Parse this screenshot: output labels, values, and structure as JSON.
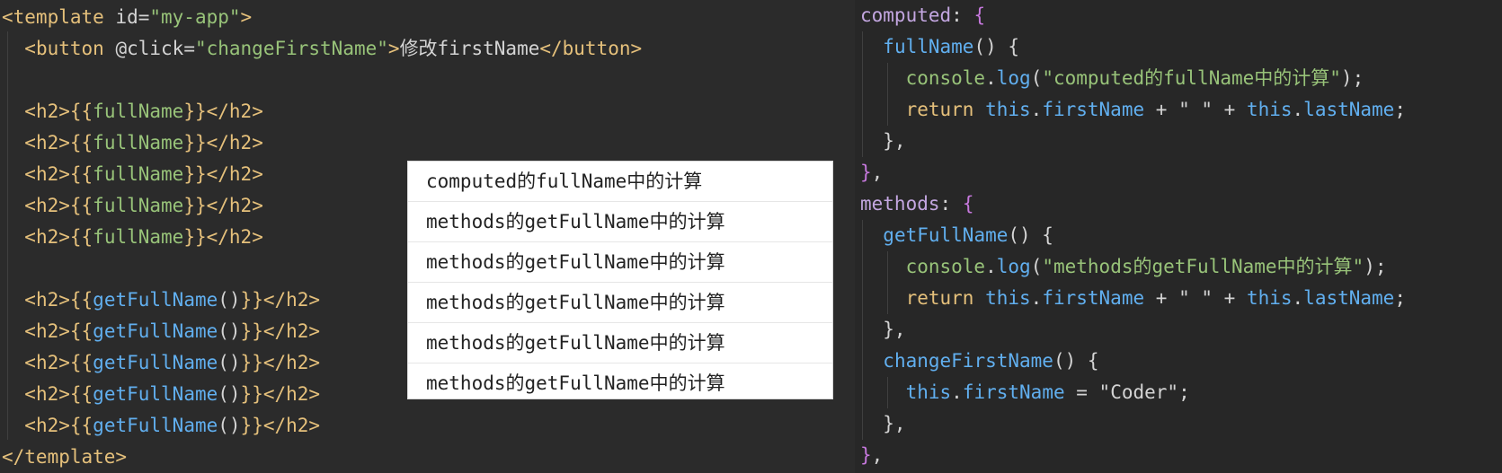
{
  "template_lines": [
    {
      "parts": [
        [
          "tag",
          "<template"
        ],
        [
          "attr",
          " id="
        ],
        [
          "str",
          "\"my-app\""
        ],
        [
          "tag",
          ">"
        ]
      ]
    },
    {
      "parts": [
        [
          "plain",
          "  "
        ],
        [
          "tag",
          "<button"
        ],
        [
          "attr",
          " @click="
        ],
        [
          "str",
          "\"changeFirstName\""
        ],
        [
          "tag",
          ">"
        ],
        [
          "plain",
          "修改firstName"
        ],
        [
          "tag",
          "</button>"
        ]
      ]
    },
    {
      "parts": [
        [
          "plain",
          ""
        ]
      ]
    },
    {
      "parts": [
        [
          "plain",
          "  "
        ],
        [
          "tag",
          "<h2>"
        ],
        [
          "mustache",
          "{{"
        ],
        [
          "expr",
          "fullName"
        ],
        [
          "mustache",
          "}}"
        ],
        [
          "tag",
          "</h2>"
        ]
      ]
    },
    {
      "parts": [
        [
          "plain",
          "  "
        ],
        [
          "tag",
          "<h2>"
        ],
        [
          "mustache",
          "{{"
        ],
        [
          "expr",
          "fullName"
        ],
        [
          "mustache",
          "}}"
        ],
        [
          "tag",
          "</h2>"
        ]
      ]
    },
    {
      "parts": [
        [
          "plain",
          "  "
        ],
        [
          "tag",
          "<h2>"
        ],
        [
          "mustache",
          "{{"
        ],
        [
          "expr",
          "fullName"
        ],
        [
          "mustache",
          "}}"
        ],
        [
          "tag",
          "</h2>"
        ]
      ]
    },
    {
      "parts": [
        [
          "plain",
          "  "
        ],
        [
          "tag",
          "<h2>"
        ],
        [
          "mustache",
          "{{"
        ],
        [
          "expr",
          "fullName"
        ],
        [
          "mustache",
          "}}"
        ],
        [
          "tag",
          "</h2>"
        ]
      ]
    },
    {
      "parts": [
        [
          "plain",
          "  "
        ],
        [
          "tag",
          "<h2>"
        ],
        [
          "mustache",
          "{{"
        ],
        [
          "expr",
          "fullName"
        ],
        [
          "mustache",
          "}}"
        ],
        [
          "tag",
          "</h2>"
        ]
      ]
    },
    {
      "parts": [
        [
          "plain",
          ""
        ]
      ]
    },
    {
      "parts": [
        [
          "plain",
          "  "
        ],
        [
          "tag",
          "<h2>"
        ],
        [
          "mustache",
          "{{"
        ],
        [
          "fn",
          "getFullName"
        ],
        [
          "plain",
          "()"
        ],
        [
          "mustache",
          "}}"
        ],
        [
          "tag",
          "</h2>"
        ]
      ]
    },
    {
      "parts": [
        [
          "plain",
          "  "
        ],
        [
          "tag",
          "<h2>"
        ],
        [
          "mustache",
          "{{"
        ],
        [
          "fn",
          "getFullName"
        ],
        [
          "plain",
          "()"
        ],
        [
          "mustache",
          "}}"
        ],
        [
          "tag",
          "</h2>"
        ]
      ]
    },
    {
      "parts": [
        [
          "plain",
          "  "
        ],
        [
          "tag",
          "<h2>"
        ],
        [
          "mustache",
          "{{"
        ],
        [
          "fn",
          "getFullName"
        ],
        [
          "plain",
          "()"
        ],
        [
          "mustache",
          "}}"
        ],
        [
          "tag",
          "</h2>"
        ]
      ]
    },
    {
      "parts": [
        [
          "plain",
          "  "
        ],
        [
          "tag",
          "<h2>"
        ],
        [
          "mustache",
          "{{"
        ],
        [
          "fn",
          "getFullName"
        ],
        [
          "plain",
          "()"
        ],
        [
          "mustache",
          "}}"
        ],
        [
          "tag",
          "</h2>"
        ]
      ]
    },
    {
      "parts": [
        [
          "plain",
          "  "
        ],
        [
          "tag",
          "<h2>"
        ],
        [
          "mustache",
          "{{"
        ],
        [
          "fn",
          "getFullName"
        ],
        [
          "plain",
          "()"
        ],
        [
          "mustache",
          "}}"
        ],
        [
          "tag",
          "</h2>"
        ]
      ]
    },
    {
      "parts": [
        [
          "tag",
          "</template>"
        ]
      ]
    }
  ],
  "script_lines": [
    {
      "parts": [
        [
          "key",
          "computed"
        ],
        [
          "plain",
          ": "
        ],
        [
          "brace",
          "{"
        ]
      ]
    },
    {
      "parts": [
        [
          "plain",
          "  "
        ],
        [
          "fn",
          "fullName"
        ],
        [
          "plain",
          "() {"
        ]
      ]
    },
    {
      "parts": [
        [
          "plain",
          "    "
        ],
        [
          "str",
          "console"
        ],
        [
          "plain",
          "."
        ],
        [
          "fn",
          "log"
        ],
        [
          "plain",
          "("
        ],
        [
          "str",
          "\"computed的fullName中的计算\""
        ],
        [
          "plain",
          ");"
        ]
      ]
    },
    {
      "parts": [
        [
          "plain",
          "    "
        ],
        [
          "kw",
          "return"
        ],
        [
          "plain",
          " "
        ],
        [
          "prop",
          "this"
        ],
        [
          "plain",
          "."
        ],
        [
          "fn",
          "firstName"
        ],
        [
          "plain",
          " + "
        ],
        [
          "strw",
          "\" \""
        ],
        [
          "plain",
          " + "
        ],
        [
          "prop",
          "this"
        ],
        [
          "plain",
          "."
        ],
        [
          "fn",
          "lastName"
        ],
        [
          "plain",
          ";"
        ]
      ]
    },
    {
      "parts": [
        [
          "plain",
          "  },"
        ]
      ]
    },
    {
      "parts": [
        [
          "brace",
          "}"
        ],
        [
          "plain",
          ","
        ]
      ]
    },
    {
      "parts": [
        [
          "key",
          "methods"
        ],
        [
          "plain",
          ": "
        ],
        [
          "brace",
          "{"
        ]
      ]
    },
    {
      "parts": [
        [
          "plain",
          "  "
        ],
        [
          "fn",
          "getFullName"
        ],
        [
          "plain",
          "() {"
        ]
      ]
    },
    {
      "parts": [
        [
          "plain",
          "    "
        ],
        [
          "str",
          "console"
        ],
        [
          "plain",
          "."
        ],
        [
          "fn",
          "log"
        ],
        [
          "plain",
          "("
        ],
        [
          "str",
          "\"methods的getFullName中的计算\""
        ],
        [
          "plain",
          ");"
        ]
      ]
    },
    {
      "parts": [
        [
          "plain",
          "    "
        ],
        [
          "kw",
          "return"
        ],
        [
          "plain",
          " "
        ],
        [
          "prop",
          "this"
        ],
        [
          "plain",
          "."
        ],
        [
          "fn",
          "firstName"
        ],
        [
          "plain",
          " + "
        ],
        [
          "strw",
          "\" \""
        ],
        [
          "plain",
          " + "
        ],
        [
          "prop",
          "this"
        ],
        [
          "plain",
          "."
        ],
        [
          "fn",
          "lastName"
        ],
        [
          "plain",
          ";"
        ]
      ]
    },
    {
      "parts": [
        [
          "plain",
          "  },"
        ]
      ]
    },
    {
      "parts": [
        [
          "plain",
          "  "
        ],
        [
          "fn",
          "changeFirstName"
        ],
        [
          "plain",
          "() {"
        ]
      ]
    },
    {
      "parts": [
        [
          "plain",
          "    "
        ],
        [
          "prop",
          "this"
        ],
        [
          "plain",
          "."
        ],
        [
          "fn",
          "firstName"
        ],
        [
          "plain",
          " = "
        ],
        [
          "strw",
          "\"Coder\""
        ],
        [
          "plain",
          ";"
        ]
      ]
    },
    {
      "parts": [
        [
          "plain",
          "  },"
        ]
      ]
    },
    {
      "parts": [
        [
          "brace",
          "}"
        ],
        [
          "plain",
          ","
        ]
      ]
    }
  ],
  "console_rows": [
    "computed的fullName中的计算",
    "methods的getFullName中的计算",
    "methods的getFullName中的计算",
    "methods的getFullName中的计算",
    "methods的getFullName中的计算",
    "methods的getFullName中的计算"
  ]
}
